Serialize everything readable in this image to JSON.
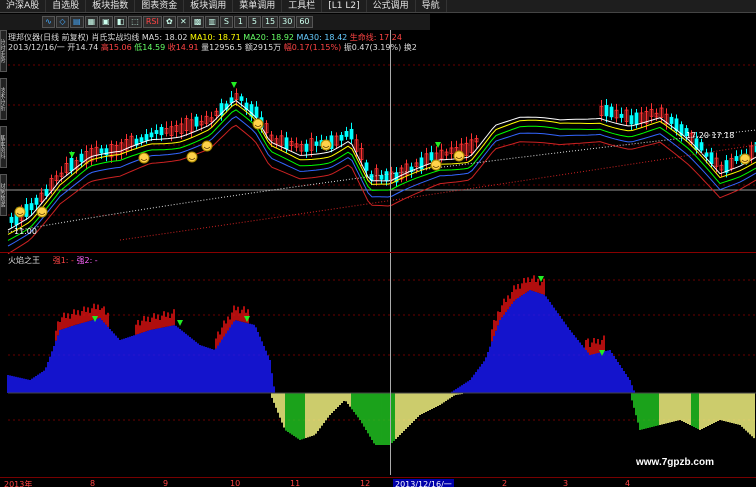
{
  "menu": [
    "沪深A股",
    "自选股",
    "板块指数",
    "图表资金",
    "板块调用",
    "菜单调用",
    "工具栏",
    "[L1 L2]",
    "公式调用",
    "导航"
  ],
  "toolbar": [
    "∿",
    "◇",
    "▤",
    "▦",
    "▣",
    "◧",
    "⬚",
    "RSI",
    "✿",
    "✕",
    "▩",
    "▥",
    "S",
    "1",
    "5",
    "15",
    "30",
    "60"
  ],
  "sidetabs": [
    "分时走势",
    "技术分析",
    "基本资料",
    "财务数据"
  ],
  "info1": {
    "stock": "理邦仪器(日线 前复权)",
    "indicator": "肖氏实战均线",
    "ma5": "MA5: 18.02",
    "ma10": "MA10: 18.71",
    "ma20": "MA20: 18.92",
    "ma30": "MA30: 18.42",
    "life": "生命线: 17.24"
  },
  "info2": {
    "date": "2013/12/16/一",
    "open": "开14.74",
    "high": "高15.06",
    "low": "低14.59",
    "close": "收14.91",
    "volume": "量12956.5",
    "amount": "额2915万",
    "change": "幅0.17(1.15%)",
    "amplitude": "振0.47(3.19%)",
    "turnover": "换2"
  },
  "indicator": {
    "name": "火焰之王",
    "line1": "强1: -",
    "line2": "强2: -"
  },
  "labels": {
    "low_price": "11.00",
    "price_marks": "17.20  17.18"
  },
  "xaxis": [
    "2013年",
    "8",
    "9",
    "10",
    "11",
    "12",
    "2013/12/16/一",
    "2",
    "3",
    "4"
  ],
  "watermark": "www.7gpzb.com",
  "colors": {
    "up": "#ff3333",
    "down": "#00ffff",
    "bar_blue": "#1a1aff",
    "bar_red": "#dd1111",
    "bar_yellow": "#ffff88",
    "bar_green": "#22cc22"
  }
}
